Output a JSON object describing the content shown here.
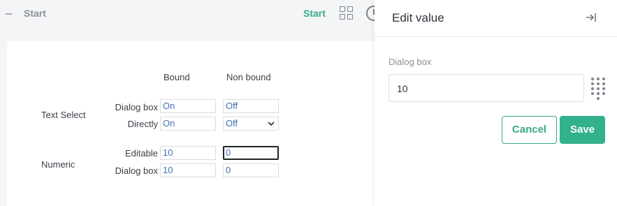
{
  "topbar": {
    "breadcrumb": "Start",
    "start_link": "Start",
    "icons": [
      "collapse-icon",
      "grid-icon",
      "clock-icon"
    ]
  },
  "form": {
    "headers": {
      "bound": "Bound",
      "non_bound": "Non bound"
    },
    "groups": {
      "text_select": "Text Select",
      "numeric": "Numeric"
    },
    "rows": {
      "ts_dialog": {
        "label": "Dialog box",
        "bound": "On",
        "non_bound": "Off"
      },
      "ts_directly": {
        "label": "Directly",
        "bound": "On",
        "non_bound": "Off"
      },
      "num_editable": {
        "label": "Editable",
        "bound": "10",
        "non_bound": "0"
      },
      "num_dialog": {
        "label": "Dialog box",
        "bound": "10",
        "non_bound": "0"
      }
    }
  },
  "panel": {
    "title": "Edit value",
    "field_label": "Dialog box",
    "field_value": "10",
    "cancel_label": "Cancel",
    "save_label": "Save"
  },
  "colors": {
    "accent": "#33b08c",
    "value_text": "#3f6fb3",
    "background": "#f4f5f7"
  }
}
